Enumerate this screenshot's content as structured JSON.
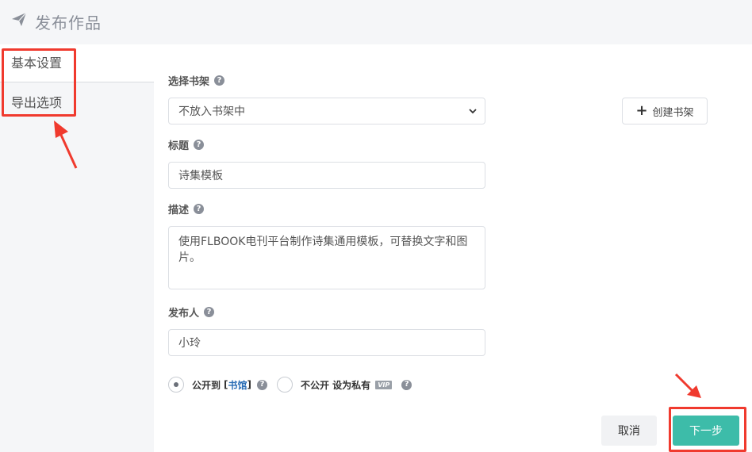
{
  "header": {
    "title": "发布作品",
    "icon": "paper-plane-icon"
  },
  "sidebar": {
    "items": [
      {
        "label": "基本设置",
        "active": true
      },
      {
        "label": "导出选项",
        "active": false
      }
    ]
  },
  "form": {
    "shelf": {
      "label": "选择书架",
      "selected": "不放入书架中",
      "create_label": "创建书架"
    },
    "title": {
      "label": "标题",
      "value": "诗集模板"
    },
    "description": {
      "label": "描述",
      "value": "使用FLBOOK电刊平台制作诗集通用模板，可替换文字和图片。"
    },
    "publisher": {
      "label": "发布人",
      "value": "小玲"
    },
    "visibility": {
      "public_label": "公开到",
      "public_link_open": "[",
      "public_link": "书馆",
      "public_link_close": "]",
      "private_label": "不公开 设为私有",
      "vip_badge": "VIP",
      "selected": "public"
    }
  },
  "actions": {
    "cancel_label": "取消",
    "next_label": "下一步"
  },
  "colors": {
    "accent": "#3dbca9",
    "annotation": "#f03a2e",
    "link": "#2a6db5"
  }
}
